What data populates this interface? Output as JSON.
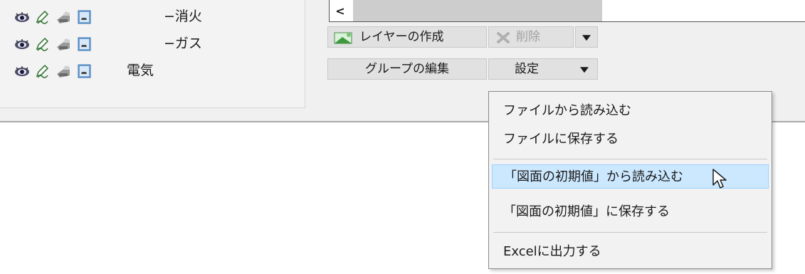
{
  "layers": [
    {
      "name": "−消火"
    },
    {
      "name": "−ガス"
    },
    {
      "name": "電気"
    }
  ],
  "buttons": {
    "create_layer": "レイヤーの作成",
    "delete": "削除",
    "edit_group": "グループの編集",
    "settings": "設定"
  },
  "scrollbar": {
    "left_arrow": "<"
  },
  "menu": {
    "items": [
      "ファイルから読み込む",
      "ファイルに保存する",
      "「図面の初期値」から読み込む",
      "「図面の初期値」に保存する",
      "Excelに出力する"
    ],
    "highlighted_index": 2
  },
  "icons": {
    "visibility": "eye-icon",
    "edit": "pencil-icon",
    "print": "print-icon",
    "display": "monitor-icon",
    "create_layer": "add-layer-icon",
    "delete": "delete-x-icon",
    "cursor": "mouse-pointer-icon"
  },
  "colors": {
    "menu_highlight": "#cce8ff",
    "menu_highlight_border": "#99d1ff",
    "button_face": "#e1e1e1",
    "panel_bg": "#f0f0f0"
  }
}
